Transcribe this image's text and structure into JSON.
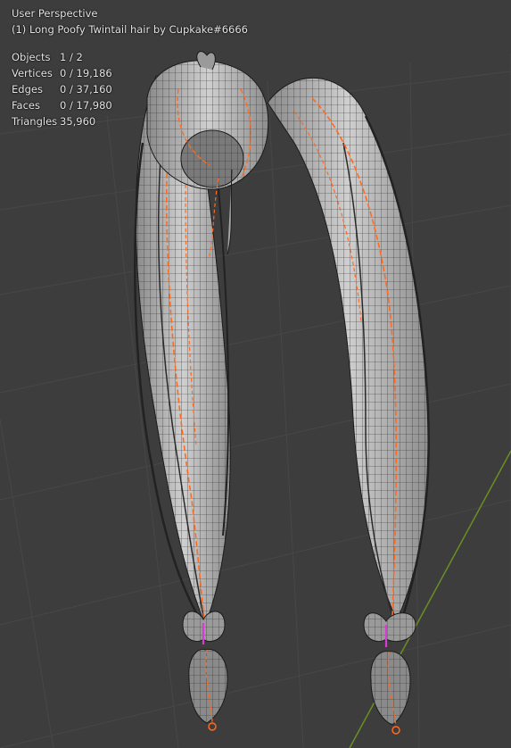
{
  "viewport": {
    "perspective_label": "User Perspective",
    "object_label": "(1) Long Poofy Twintail hair by Cupkake#6666"
  },
  "stats": [
    {
      "label": "Objects",
      "value": "1 / 2"
    },
    {
      "label": "Vertices",
      "value": "0 / 19,186"
    },
    {
      "label": "Edges",
      "value": "0 / 37,160"
    },
    {
      "label": "Faces",
      "value": "0 / 17,980"
    },
    {
      "label": "Triangles",
      "value": "35,960"
    }
  ],
  "colors": {
    "background": "#3d3d3d",
    "grid_line": "#474747",
    "axis_y": "#6b8e23",
    "mesh_fill": "#bdbdbd",
    "wire": "#1a1a1a",
    "seam": "#ff6a1f",
    "selected_edge": "#d63bd6"
  }
}
